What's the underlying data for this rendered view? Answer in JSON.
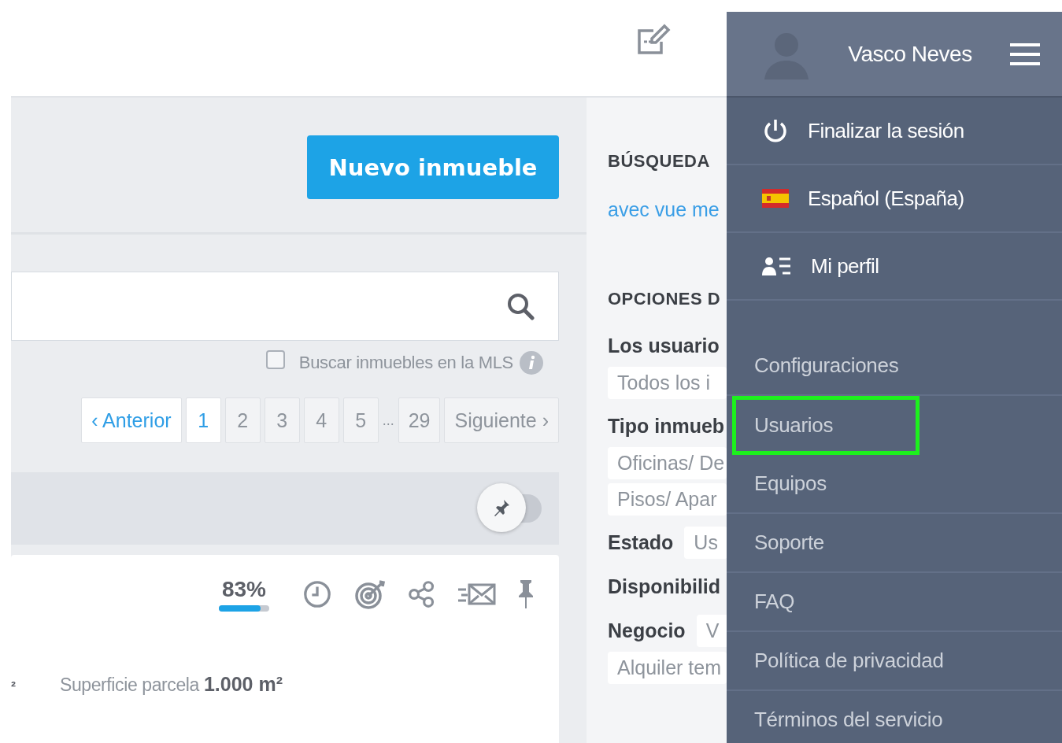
{
  "new_button": "Nuevo inmueble",
  "mls_checkbox": {
    "label": "Buscar inmuebles en la MLS",
    "checked": false
  },
  "pagination": {
    "previous": "‹ Anterior",
    "pages": [
      {
        "label": "1",
        "selected": true
      },
      {
        "label": "2",
        "selected": false
      },
      {
        "label": "3",
        "selected": false
      },
      {
        "label": "4",
        "selected": false
      },
      {
        "label": "5",
        "selected": false
      }
    ],
    "ellipsis": "...",
    "last_page": {
      "label": "29",
      "selected": false
    },
    "next": "Siguiente ›"
  },
  "pin_toggle": {
    "on": false
  },
  "listing": {
    "completeness": "83%",
    "level": 0.83,
    "area_unit_fragment": "²",
    "plot_label": "Superficie parcela",
    "plot_value": "1.000 m²"
  },
  "sidebar": {
    "saved_searches_heading": "BÚSQUEDA",
    "saved_search_link": "avec vue me",
    "options_heading": "OPCIONES D",
    "filters": [
      {
        "label": "Los usuario",
        "values": [
          "Todos los i"
        ]
      },
      {
        "label": "Tipo inmueb",
        "values": [
          "Oficinas/ De",
          "Pisos/ Apar"
        ]
      },
      {
        "label": "Estado",
        "inline_value": "Us"
      },
      {
        "label": "Disponibilid"
      },
      {
        "label": "Negocio",
        "inline_value": "V",
        "values": [
          "Alquiler tem"
        ]
      }
    ]
  },
  "user_menu": {
    "name": "Vasco Neves",
    "actions": [
      {
        "kind": "logout",
        "label": "Finalizar la sesión"
      },
      {
        "kind": "language",
        "label": "Español (España)"
      },
      {
        "kind": "profile",
        "label": "Mi perfil"
      }
    ],
    "links": [
      {
        "label": "Configuraciones",
        "highlighted": false
      },
      {
        "label": "Usuarios",
        "highlighted": true
      },
      {
        "label": "Equipos",
        "highlighted": false
      },
      {
        "label": "Soporte",
        "highlighted": false
      },
      {
        "label": "FAQ",
        "highlighted": false
      },
      {
        "label": "Política de privacidad",
        "highlighted": false
      },
      {
        "label": "Términos del servicio",
        "highlighted": false
      }
    ]
  }
}
